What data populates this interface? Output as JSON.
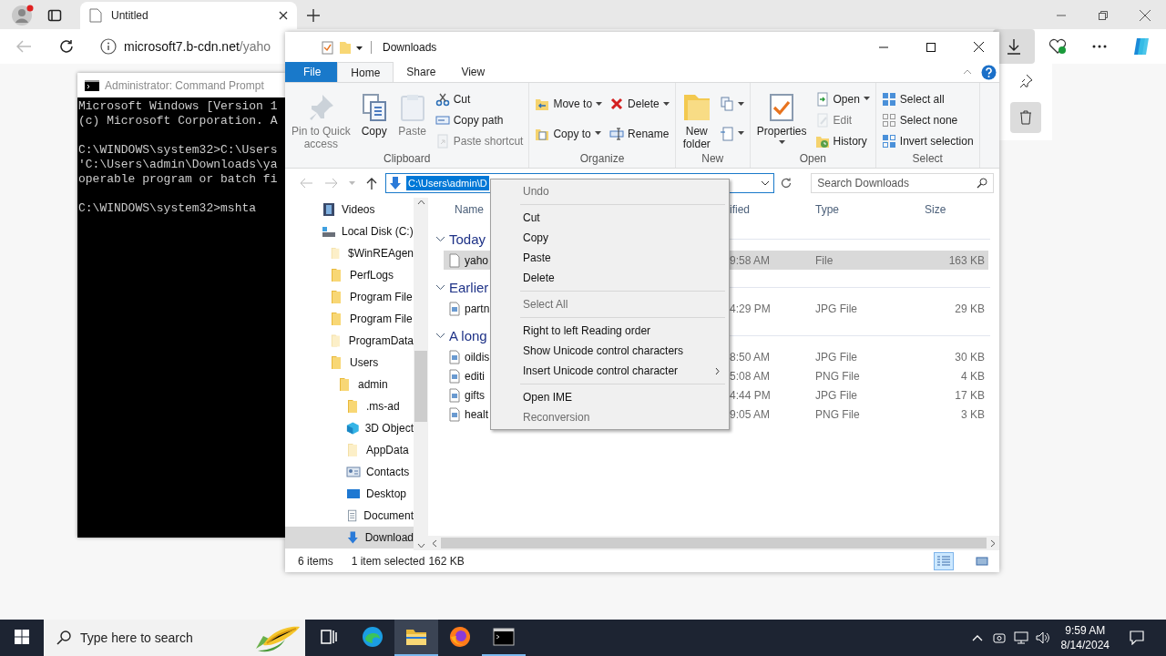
{
  "browser": {
    "tab_title": "Untitled",
    "url_host": "microsoft7.b-cdn.net",
    "url_path": "/yaho"
  },
  "cmd": {
    "title": "Administrator: Command Prompt",
    "blocks": [
      [
        "Microsoft Windows [Version 1",
        "(c) Microsoft Corporation. A"
      ],
      [
        "C:\\WINDOWS\\system32>C:\\Users",
        "'C:\\Users\\admin\\Downloads\\ya",
        "operable program or batch fi"
      ],
      [
        "C:\\WINDOWS\\system32>mshta"
      ]
    ]
  },
  "explorer": {
    "title": "Downloads",
    "ribbon_tabs": [
      {
        "label": "File",
        "kind": "file",
        "selected": false
      },
      {
        "label": "Home",
        "kind": "tab",
        "selected": true
      },
      {
        "label": "Share",
        "kind": "tab",
        "selected": false
      },
      {
        "label": "View",
        "kind": "tab",
        "selected": false
      }
    ],
    "ribbon_groups": [
      {
        "label": "Clipboard",
        "columns": [
          [
            {
              "kind": "large",
              "label": "Pin to Quick\naccess",
              "disabled": true,
              "dropdown": false
            }
          ],
          [
            {
              "kind": "large",
              "label": "Copy",
              "disabled": false,
              "dropdown": false
            }
          ],
          [
            {
              "kind": "large",
              "label": "Paste",
              "disabled": true,
              "dropdown": false
            }
          ],
          [
            {
              "kind": "small",
              "label": "Cut",
              "disabled": false,
              "dropdown": false
            },
            {
              "kind": "small",
              "label": "Copy path",
              "disabled": false,
              "dropdown": false
            },
            {
              "kind": "small",
              "label": "Paste shortcut",
              "disabled": true,
              "dropdown": false
            }
          ]
        ]
      },
      {
        "label": "Organize",
        "columns": [
          [
            {
              "kind": "small",
              "label": "Move to",
              "disabled": false,
              "dropdown": true
            },
            {
              "kind": "small",
              "label": "Copy to",
              "disabled": false,
              "dropdown": true
            }
          ],
          [
            {
              "kind": "small",
              "label": "Delete",
              "disabled": false,
              "dropdown": true
            },
            {
              "kind": "small",
              "label": "Rename",
              "disabled": false,
              "dropdown": false
            }
          ]
        ]
      },
      {
        "label": "New",
        "columns": [
          [
            {
              "kind": "large",
              "label": "New\nfolder",
              "disabled": false,
              "dropdown": false
            }
          ],
          [
            {
              "kind": "small",
              "disabled": false,
              "dropdown": true
            },
            {
              "kind": "small",
              "disabled": false,
              "dropdown": true
            }
          ]
        ]
      },
      {
        "label": "Open",
        "columns": [
          [
            {
              "kind": "large",
              "label": "Properties",
              "disabled": false,
              "dropdown": true
            }
          ],
          [
            {
              "kind": "small",
              "label": "Open",
              "disabled": false,
              "dropdown": true
            },
            {
              "kind": "small",
              "label": "Edit",
              "disabled": true,
              "dropdown": false
            },
            {
              "kind": "small",
              "label": "History",
              "disabled": false,
              "dropdown": false
            }
          ]
        ]
      },
      {
        "label": "Select",
        "columns": [
          [
            {
              "kind": "small",
              "label": "Select all",
              "disabled": false,
              "dropdown": false
            },
            {
              "kind": "small",
              "label": "Select none",
              "disabled": false,
              "dropdown": false
            },
            {
              "kind": "small",
              "label": "Invert selection",
              "disabled": false,
              "dropdown": false
            }
          ]
        ]
      }
    ],
    "address": "C:\\Users\\admin\\D",
    "search": {
      "placeholder": "Search Downloads"
    },
    "nav": [
      {
        "label": "Videos",
        "kind": "videos",
        "selected": false
      },
      {
        "label": "Local Disk (C:)",
        "kind": "drive",
        "selected": false,
        "children": [
          {
            "label": "$WinREAgen",
            "kind": "hidden_folder",
            "selected": false
          },
          {
            "label": "PerfLogs",
            "kind": "folder",
            "selected": false
          },
          {
            "label": "Program File",
            "kind": "folder",
            "selected": false
          },
          {
            "label": "Program File",
            "kind": "folder",
            "selected": false
          },
          {
            "label": "ProgramData",
            "kind": "hidden_folder",
            "selected": false
          },
          {
            "label": "Users",
            "kind": "folder",
            "selected": false,
            "children": [
              {
                "label": "admin",
                "kind": "folder",
                "selected": false,
                "children": [
                  {
                    "label": ".ms-ad",
                    "kind": "folder",
                    "selected": false
                  },
                  {
                    "label": "3D Object",
                    "kind": "objects",
                    "selected": false
                  },
                  {
                    "label": "AppData",
                    "kind": "hidden_folder",
                    "selected": false
                  },
                  {
                    "label": "Contacts",
                    "kind": "contacts",
                    "selected": false
                  },
                  {
                    "label": "Desktop",
                    "kind": "desktop",
                    "selected": false
                  },
                  {
                    "label": "Document",
                    "kind": "documents",
                    "selected": false
                  },
                  {
                    "label": "Download",
                    "kind": "downloads",
                    "selected": true
                  }
                ]
              }
            ]
          }
        ]
      }
    ],
    "columns": [
      "Name",
      "ified",
      "Type",
      "Size"
    ],
    "groups": [
      {
        "label": "Today",
        "files": [
          {
            "name": "yaho",
            "kind": "file",
            "date": "9:58 AM",
            "type": "File",
            "size": "163 KB",
            "selected": true
          }
        ]
      },
      {
        "label": "Earlier",
        "files": [
          {
            "name": "partn",
            "kind": "image",
            "date": "4:29 PM",
            "type": "JPG File",
            "size": "29 KB",
            "selected": false
          }
        ]
      },
      {
        "label": "A long",
        "files": [
          {
            "name": "oildis",
            "kind": "image",
            "date": "8:50 AM",
            "type": "JPG File",
            "size": "30 KB",
            "selected": false
          },
          {
            "name": "editi",
            "kind": "image",
            "date": "5:08 AM",
            "type": "PNG File",
            "size": "4 KB",
            "selected": false
          },
          {
            "name": "gifts",
            "kind": "image",
            "date": "4:44 PM",
            "type": "JPG File",
            "size": "17 KB",
            "selected": false
          },
          {
            "name": "healt",
            "kind": "image",
            "date": "9:05 AM",
            "type": "PNG File",
            "size": "3 KB",
            "selected": false
          }
        ]
      }
    ],
    "status": {
      "count": "6 items",
      "selection": "1 item selected",
      "size": "162 KB"
    },
    "views": [
      {
        "kind": "details",
        "selected": true
      },
      {
        "kind": "large",
        "selected": false
      }
    ]
  },
  "context_menu": [
    {
      "kind": "item",
      "label": "Undo",
      "disabled": true,
      "submenu": false
    },
    {
      "kind": "separator"
    },
    {
      "kind": "item",
      "label": "Cut",
      "disabled": false,
      "submenu": false
    },
    {
      "kind": "item",
      "label": "Copy",
      "disabled": false,
      "submenu": false
    },
    {
      "kind": "item",
      "label": "Paste",
      "disabled": false,
      "submenu": false
    },
    {
      "kind": "item",
      "label": "Delete",
      "disabled": false,
      "submenu": false
    },
    {
      "kind": "separator"
    },
    {
      "kind": "item",
      "label": "Select All",
      "disabled": true,
      "submenu": false
    },
    {
      "kind": "separator"
    },
    {
      "kind": "item",
      "label": "Right to left Reading order",
      "disabled": false,
      "submenu": false
    },
    {
      "kind": "item",
      "label": "Show Unicode control characters",
      "disabled": false,
      "submenu": false
    },
    {
      "kind": "item",
      "label": "Insert Unicode control character",
      "disabled": false,
      "submenu": true
    },
    {
      "kind": "separator"
    },
    {
      "kind": "item",
      "label": "Open IME",
      "disabled": false,
      "submenu": false
    },
    {
      "kind": "item",
      "label": "Reconversion",
      "disabled": true,
      "submenu": false
    }
  ],
  "taskbar": {
    "search_placeholder": "Type here to search",
    "apps": [
      {
        "kind": "taskview",
        "active": false,
        "running": false
      },
      {
        "kind": "edge",
        "active": false,
        "running": false
      },
      {
        "kind": "explorer",
        "active": true,
        "running": true
      },
      {
        "kind": "firefox",
        "active": false,
        "running": false
      },
      {
        "kind": "cmd",
        "active": false,
        "running": true
      }
    ],
    "time": "9:59 AM",
    "date": "8/14/2024"
  }
}
